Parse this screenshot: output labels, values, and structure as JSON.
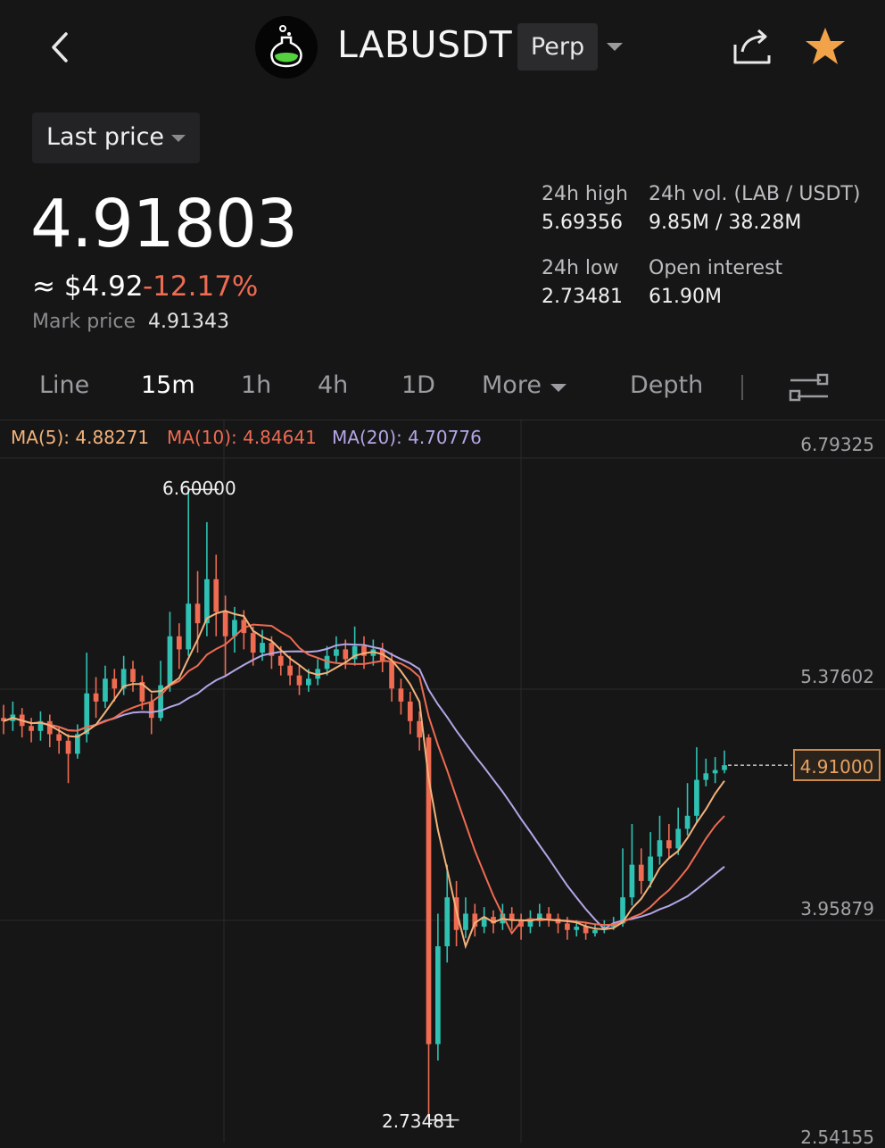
{
  "header": {
    "pair": "LABUSDT",
    "contract_type": "Perp",
    "icons": [
      "back-arrow-icon",
      "lab-flask-logo",
      "chevron-down-icon",
      "share-icon",
      "star-icon"
    ],
    "favorite_color": "#f2a34a"
  },
  "price_source": {
    "label": "Last price"
  },
  "ticker": {
    "last_price": "4.91803",
    "usd_approx": "≈ $4.92",
    "change_pct": "-12.17%",
    "mark_price_label": "Mark price",
    "mark_price": "4.91343",
    "high_label": "24h high",
    "high": "5.69356",
    "low_label": "24h low",
    "low": "2.73481",
    "vol_label": "24h vol. (LAB / USDT)",
    "vol": "9.85M / 38.28M",
    "oi_label": "Open interest",
    "oi": "61.90M",
    "down_color": "#ef6b51"
  },
  "tabs": {
    "line": "Line",
    "m15": "15m",
    "h1": "1h",
    "h4": "4h",
    "d1": "1D",
    "more": "More",
    "depth": "Depth",
    "active": "15m"
  },
  "indicators": {
    "ma5": "MA(5): 4.88271",
    "ma10": "MA(10): 4.84641",
    "ma20": "MA(20): 4.70776",
    "ma5_color": "#f3b27a",
    "ma10_color": "#ef6b51",
    "ma20_color": "#b4a6e6"
  },
  "chart_data": {
    "type": "candlestick",
    "y_axis_labels": [
      "6.79325",
      "5.37602",
      "3.95879",
      "2.54155"
    ],
    "ylim": [
      2.54155,
      6.79325
    ],
    "current_price_label": "4.91000",
    "current_price": 4.91,
    "high_marker": "6.60000",
    "high_value": 6.6,
    "low_marker": "2.73481",
    "low_value": 2.73481,
    "up_color": "#2fc2b2",
    "down_color": "#ef6b51",
    "candles": [
      [
        5.2,
        5.18,
        5.28,
        5.1
      ],
      [
        5.18,
        5.22,
        5.3,
        5.12
      ],
      [
        5.22,
        5.15,
        5.26,
        5.08
      ],
      [
        5.15,
        5.12,
        5.2,
        5.05
      ],
      [
        5.12,
        5.18,
        5.24,
        5.06
      ],
      [
        5.18,
        5.1,
        5.22,
        5.02
      ],
      [
        5.1,
        5.06,
        5.14,
        4.98
      ],
      [
        5.06,
        4.98,
        5.1,
        4.8
      ],
      [
        4.98,
        5.1,
        5.16,
        4.95
      ],
      [
        5.1,
        5.35,
        5.6,
        5.05
      ],
      [
        5.35,
        5.3,
        5.45,
        5.2
      ],
      [
        5.3,
        5.44,
        5.52,
        5.26
      ],
      [
        5.44,
        5.38,
        5.5,
        5.3
      ],
      [
        5.38,
        5.5,
        5.58,
        5.34
      ],
      [
        5.5,
        5.42,
        5.55,
        5.36
      ],
      [
        5.42,
        5.3,
        5.46,
        5.25
      ],
      [
        5.3,
        5.2,
        5.35,
        5.1
      ],
      [
        5.2,
        5.4,
        5.55,
        5.18
      ],
      [
        5.4,
        5.7,
        5.85,
        5.36
      ],
      [
        5.7,
        5.62,
        5.78,
        5.5
      ],
      [
        5.62,
        5.9,
        6.6,
        5.58
      ],
      [
        5.9,
        5.78,
        6.1,
        5.6
      ],
      [
        5.78,
        6.05,
        6.4,
        5.7
      ],
      [
        6.05,
        5.85,
        6.2,
        5.7
      ],
      [
        5.85,
        5.7,
        5.95,
        5.45
      ],
      [
        5.7,
        5.8,
        5.88,
        5.6
      ],
      [
        5.8,
        5.72,
        5.86,
        5.62
      ],
      [
        5.72,
        5.6,
        5.76,
        5.52
      ],
      [
        5.6,
        5.66,
        5.74,
        5.55
      ],
      [
        5.66,
        5.58,
        5.7,
        5.5
      ],
      [
        5.58,
        5.52,
        5.64,
        5.46
      ],
      [
        5.52,
        5.46,
        5.58,
        5.4
      ],
      [
        5.46,
        5.4,
        5.52,
        5.34
      ],
      [
        5.4,
        5.44,
        5.5,
        5.36
      ],
      [
        5.44,
        5.5,
        5.56,
        5.4
      ],
      [
        5.5,
        5.58,
        5.64,
        5.46
      ],
      [
        5.58,
        5.62,
        5.7,
        5.54
      ],
      [
        5.62,
        5.56,
        5.68,
        5.5
      ],
      [
        5.56,
        5.64,
        5.76,
        5.52
      ],
      [
        5.64,
        5.58,
        5.7,
        5.5
      ],
      [
        5.58,
        5.62,
        5.68,
        5.52
      ],
      [
        5.62,
        5.55,
        5.66,
        5.48
      ],
      [
        5.55,
        5.38,
        5.6,
        5.3
      ],
      [
        5.38,
        5.3,
        5.44,
        5.22
      ],
      [
        5.3,
        5.18,
        5.36,
        5.1
      ],
      [
        5.18,
        5.08,
        5.24,
        5.0
      ],
      [
        5.08,
        3.2,
        5.1,
        2.73481
      ],
      [
        3.2,
        3.8,
        4.0,
        3.1
      ],
      [
        3.8,
        4.1,
        4.3,
        3.7
      ],
      [
        4.1,
        3.9,
        4.2,
        3.8
      ],
      [
        3.9,
        4.0,
        4.1,
        3.85
      ],
      [
        4.0,
        3.92,
        4.06,
        3.86
      ],
      [
        3.92,
        3.98,
        4.04,
        3.88
      ],
      [
        3.98,
        3.94,
        4.02,
        3.88
      ],
      [
        3.94,
        4.0,
        4.06,
        3.9
      ],
      [
        4.0,
        3.96,
        4.04,
        3.9
      ],
      [
        3.96,
        3.92,
        4.0,
        3.84
      ],
      [
        3.92,
        3.96,
        4.02,
        3.88
      ],
      [
        3.96,
        4.0,
        4.06,
        3.92
      ],
      [
        4.0,
        3.97,
        4.04,
        3.92
      ],
      [
        3.97,
        3.94,
        4.0,
        3.88
      ],
      [
        3.94,
        3.9,
        3.98,
        3.84
      ],
      [
        3.9,
        3.92,
        3.96,
        3.86
      ],
      [
        3.92,
        3.88,
        3.95,
        3.84
      ],
      [
        3.88,
        3.9,
        3.94,
        3.86
      ],
      [
        3.9,
        3.92,
        3.96,
        3.88
      ],
      [
        3.92,
        3.94,
        3.98,
        3.9
      ],
      [
        3.94,
        4.1,
        4.4,
        3.92
      ],
      [
        4.1,
        4.3,
        4.55,
        4.05
      ],
      [
        4.3,
        4.2,
        4.4,
        4.12
      ],
      [
        4.2,
        4.35,
        4.5,
        4.16
      ],
      [
        4.35,
        4.45,
        4.6,
        4.3
      ],
      [
        4.45,
        4.4,
        4.55,
        4.34
      ],
      [
        4.4,
        4.52,
        4.65,
        4.36
      ],
      [
        4.52,
        4.6,
        4.8,
        4.48
      ],
      [
        4.6,
        4.82,
        5.02,
        4.56
      ],
      [
        4.82,
        4.86,
        4.95,
        4.78
      ],
      [
        4.86,
        4.88,
        4.96,
        4.8
      ],
      [
        4.88,
        4.91,
        5.0,
        4.86
      ]
    ]
  }
}
